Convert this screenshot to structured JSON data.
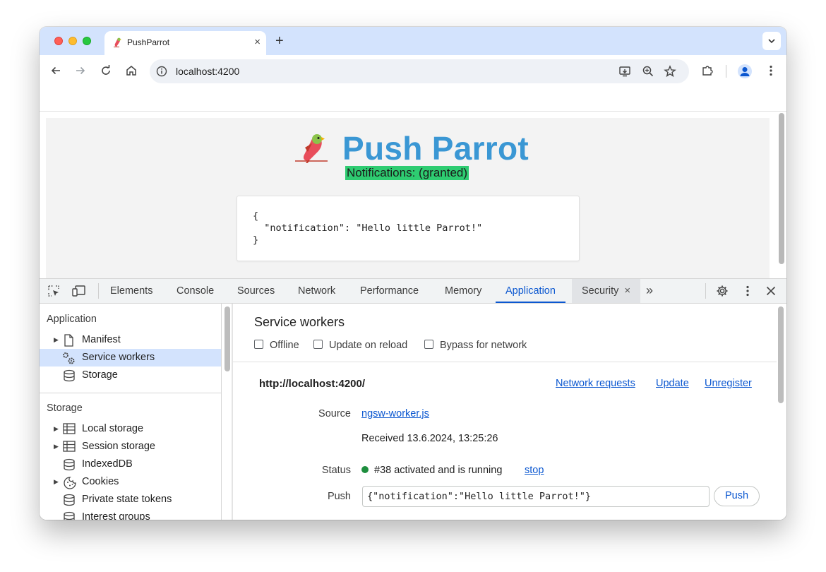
{
  "browser": {
    "tab_title": "PushParrot",
    "tab_close": "×",
    "new_tab": "+",
    "url": "localhost:4200"
  },
  "page": {
    "app_title": "Push Parrot",
    "notification_status": "Notifications: (granted)",
    "json_preview": "{\n  \"notification\": \"Hello little Parrot!\"\n}"
  },
  "devtools": {
    "tabs": [
      {
        "label": "Elements"
      },
      {
        "label": "Console"
      },
      {
        "label": "Sources"
      },
      {
        "label": "Network"
      },
      {
        "label": "Performance"
      },
      {
        "label": "Memory"
      },
      {
        "label": "Application"
      },
      {
        "label": "Security"
      }
    ],
    "active_tab": "Application",
    "close_tab_glyph": "×",
    "more_tabs_glyph": "»",
    "sidebar": {
      "application_heading": "Application",
      "application_items": [
        {
          "label": "Manifest",
          "icon": "document-icon"
        },
        {
          "label": "Service workers",
          "icon": "gears-icon"
        },
        {
          "label": "Storage",
          "icon": "database-icon"
        }
      ],
      "storage_heading": "Storage",
      "storage_items": [
        {
          "label": "Local storage",
          "icon": "table-icon"
        },
        {
          "label": "Session storage",
          "icon": "table-icon"
        },
        {
          "label": "IndexedDB",
          "icon": "database-icon"
        },
        {
          "label": "Cookies",
          "icon": "cookie-icon"
        },
        {
          "label": "Private state tokens",
          "icon": "database-icon"
        },
        {
          "label": "Interest groups",
          "icon": "database-icon"
        }
      ]
    },
    "service_workers": {
      "title": "Service workers",
      "checkboxes": {
        "offline": "Offline",
        "update_on_reload": "Update on reload",
        "bypass_for_network": "Bypass for network"
      },
      "origin": "http://localhost:4200/",
      "actions": {
        "network_requests": "Network requests",
        "update": "Update",
        "unregister": "Unregister"
      },
      "source_label": "Source",
      "source_file": "ngsw-worker.js",
      "received": "Received 13.6.2024, 13:25:26",
      "status_label": "Status",
      "status_text": "#38 activated and is running",
      "stop_link": "stop",
      "push_label": "Push",
      "push_value": "{\"notification\":\"Hello little Parrot!\"}",
      "push_button": "Push"
    }
  },
  "colors": {
    "accent": "#0b57d0",
    "title_blue": "#3a97d4",
    "granted_green": "#2ecc71",
    "status_green": "#1e8e3e"
  }
}
